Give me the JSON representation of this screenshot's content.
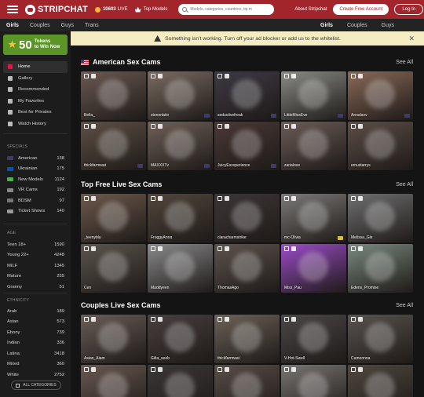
{
  "header": {
    "logo": "STRIPCHAT",
    "live_count": "10603",
    "live_label": "LIVE",
    "top_models": "Top Models",
    "search_placeholder": "Models, categories, countries, tip m",
    "about": "About Stripchat",
    "create_account": "Create Free Account",
    "login": "Log In"
  },
  "category_tabs_left": [
    "Girls",
    "Couples",
    "Guys",
    "Trans"
  ],
  "category_tabs_right": [
    "Girls",
    "Couples",
    "Guys"
  ],
  "warning": "Something isn't working. Turn off your ad blocker or add us to the whitelist.",
  "sidebar": {
    "promo_number": "50",
    "promo_line1": "Tokens",
    "promo_line2": "to Win Now",
    "nav": [
      "Home",
      "Gallery",
      "Recommended",
      "My Favorites",
      "Best for Privates",
      "Watch History"
    ],
    "specials_title": "SPECIALS",
    "specials": [
      {
        "label": "American",
        "count": "138",
        "color": "#3c3b6e"
      },
      {
        "label": "Ukrainian",
        "count": "175",
        "color": "#0057b7"
      },
      {
        "label": "New Models",
        "count": "1124",
        "color": "#4caf50"
      },
      {
        "label": "VR Cams",
        "count": "192",
        "color": "#888888"
      },
      {
        "label": "BDSM",
        "count": "97",
        "color": "#777777"
      },
      {
        "label": "Ticket Shows",
        "count": "140",
        "color": "#999999"
      }
    ],
    "age_title": "AGE",
    "age": [
      {
        "label": "Teen 18+",
        "count": "1590"
      },
      {
        "label": "Young 22+",
        "count": "4248"
      },
      {
        "label": "MILF",
        "count": "1345"
      },
      {
        "label": "Mature",
        "count": "255"
      },
      {
        "label": "Granny",
        "count": "51"
      }
    ],
    "ethnicity_title": "ETHNICITY",
    "ethnicity": [
      {
        "label": "Arab",
        "count": "189"
      },
      {
        "label": "Asian",
        "count": "573"
      },
      {
        "label": "Ebony",
        "count": "739"
      },
      {
        "label": "Indian",
        "count": "336"
      },
      {
        "label": "Latina",
        "count": "3418"
      },
      {
        "label": "Mixed",
        "count": "360"
      },
      {
        "label": "White",
        "count": "2752"
      }
    ],
    "all_categories": "ALL CATEGORIES"
  },
  "sections": [
    {
      "title": "American Sex Cams",
      "see_all": "See All",
      "tiles": [
        {
          "name": "Bella_",
          "color": "#6b5a52",
          "flag": ""
        },
        {
          "name": "stonertativ",
          "color": "#7a6c62",
          "flag": "#3c3b6e"
        },
        {
          "name": "seductivefreak",
          "color": "#3e3a44",
          "flag": "#3c3b6e"
        },
        {
          "name": "LittleMissEve",
          "color": "#8a8c86",
          "flag": "#3c3b6e"
        },
        {
          "name": "Annalavv",
          "color": "#8a6a58",
          "flag": "#3c3b6e"
        },
        {
          "name": "thickfarmwat",
          "color": "#5e5146",
          "flag": "#3c3b6e"
        },
        {
          "name": "MAXXXTv",
          "color": "#6f6158",
          "flag": "#3c3b6e"
        },
        {
          "name": "JuicyEssxperience",
          "color": "#4a3936",
          "flag": "#3c3b6e"
        },
        {
          "name": "zarialove",
          "color": "#6c5d58",
          "flag": ""
        },
        {
          "name": "emustarrys",
          "color": "#5c4e48",
          "flag": ""
        }
      ]
    },
    {
      "title": "Top Free Live Sex Cams",
      "see_all": "See All",
      "tiles": [
        {
          "name": "_teenyblu",
          "color": "#6e5a4c",
          "flag": ""
        },
        {
          "name": "FroggyAnna",
          "color": "#52473c",
          "flag": ""
        },
        {
          "name": "claracharmstrike",
          "color": "#3e3636",
          "flag": ""
        },
        {
          "name": "mc-Olivia",
          "color": "#7c7a78",
          "flag": "#e0c020"
        },
        {
          "name": "Melissa_Gle",
          "color": "#707071",
          "flag": ""
        },
        {
          "name": "Cen",
          "color": "#5c554e",
          "flag": ""
        },
        {
          "name": "Maddyeen",
          "color": "#8a8a8c",
          "flag": ""
        },
        {
          "name": "ThomasAgo",
          "color": "#5e544e",
          "flag": ""
        },
        {
          "name": "Miss_Pau",
          "color": "#9c4cc8",
          "flag": ""
        },
        {
          "name": "Edens_Promise",
          "color": "#7a8a80",
          "flag": ""
        }
      ]
    },
    {
      "title": "Couples Live Sex Cams",
      "see_all": "See All",
      "tiles": [
        {
          "name": "Asian_Aiam",
          "color": "#6a5e58",
          "flag": ""
        },
        {
          "name": "Gilta_seeb",
          "color": "#494040",
          "flag": ""
        },
        {
          "name": "thickfarmwat",
          "color": "#6c6258",
          "flag": ""
        },
        {
          "name": "V-Hot-Swell",
          "color": "#4c4848",
          "flag": ""
        },
        {
          "name": "Cumonnna",
          "color": "#5a5450",
          "flag": ""
        },
        {
          "name": "",
          "color": "#6a5a52",
          "flag": ""
        },
        {
          "name": "",
          "color": "#3c3838",
          "flag": ""
        },
        {
          "name": "",
          "color": "#5a4e48",
          "flag": ""
        },
        {
          "name": "",
          "color": "#7a7674",
          "flag": ""
        },
        {
          "name": "",
          "color": "#504840",
          "flag": ""
        }
      ]
    }
  ]
}
